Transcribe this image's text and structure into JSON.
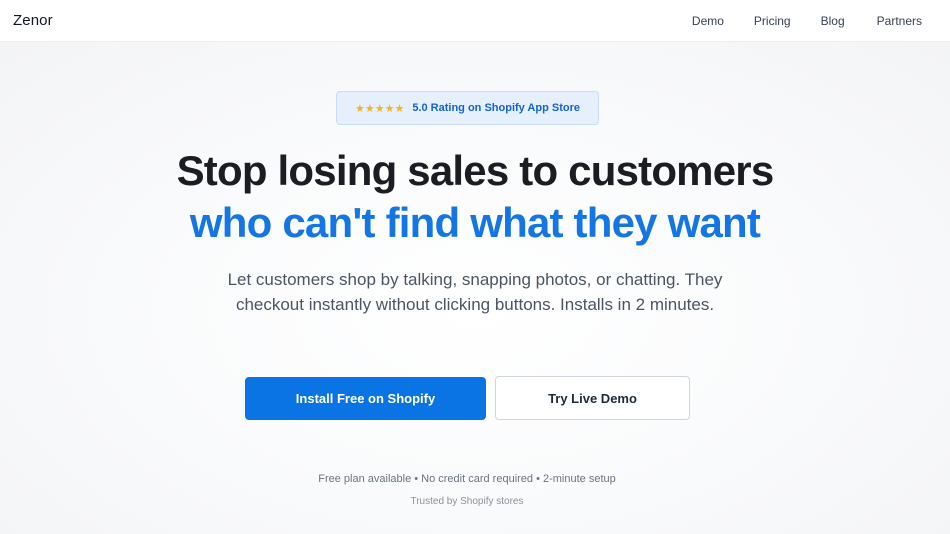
{
  "navbar": {
    "logo": "Zenor",
    "links": [
      "Demo",
      "Pricing",
      "Blog",
      "Partners"
    ]
  },
  "hero": {
    "badge": {
      "stars": "★★★★★",
      "text": "5.0 Rating on Shopify App Store"
    },
    "headline_line1": "Stop losing sales to customers",
    "headline_line2": "who can't find what they want",
    "subtext": "Let customers shop by talking, snapping photos, or chatting. They checkout instantly without clicking buttons. Installs in 2 minutes.",
    "primary_cta": "Install Free on Shopify",
    "secondary_cta": "Try Live Demo",
    "fine_print": "Free plan available • No credit card required • 2-minute setup",
    "trusted": "Trusted by Shopify stores"
  },
  "colors": {
    "accent": "#0b74e5",
    "headline_accent": "#1476e4",
    "stars": "#f5b31f",
    "badge_bg": "#e6f0fd"
  }
}
